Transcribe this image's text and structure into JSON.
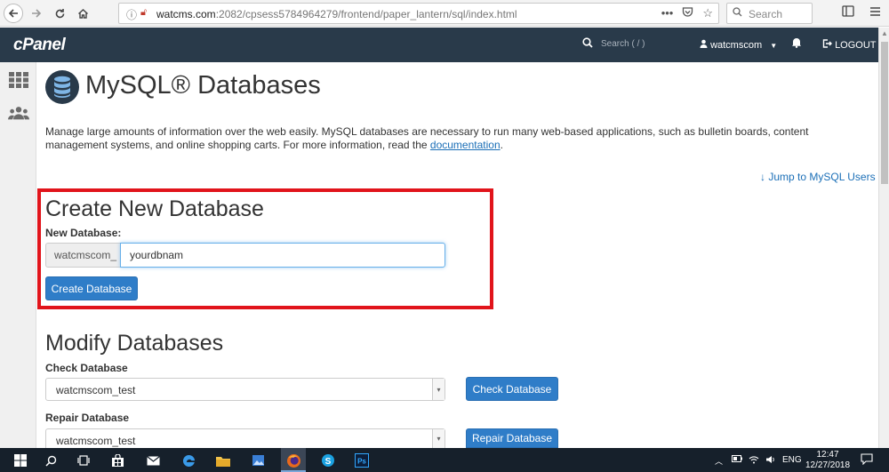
{
  "browser": {
    "url_host": "watcms.com",
    "url_rest": ":2082/cpsess5784964279/frontend/paper_lantern/sql/index.html",
    "search_placeholder": "Search",
    "more_icon": "•••"
  },
  "header": {
    "logo": "cPanel",
    "search_placeholder": "Search ( / )",
    "username": "watcmscom",
    "logout_label": "LOGOUT"
  },
  "page": {
    "title": "MySQL® Databases",
    "description": "Manage large amounts of information over the web easily. MySQL databases are necessary to run many web-based applications, such as bulletin boards, content management systems, and online shopping carts. For more information, read the ",
    "doc_link": "documentation",
    "doc_suffix": ".",
    "jump_link": "Jump to MySQL Users"
  },
  "create": {
    "heading": "Create New Database",
    "label": "New Database:",
    "prefix": "watcmscom_",
    "value": "yourdbnam",
    "button": "Create Database"
  },
  "modify": {
    "heading": "Modify Databases",
    "check_label": "Check Database",
    "check_value": "watcmscom_test",
    "check_button": "Check Database",
    "repair_label": "Repair Database",
    "repair_value": "watcmscom_test",
    "repair_button": "Repair Database"
  },
  "taskbar": {
    "lang": "ENG",
    "time": "12:47",
    "date": "12/27/2018"
  },
  "colors": {
    "header_bg": "#293a4a",
    "accent_button": "#2f7dc8",
    "highlight_box": "#e1141b",
    "link": "#1b6fb7"
  }
}
